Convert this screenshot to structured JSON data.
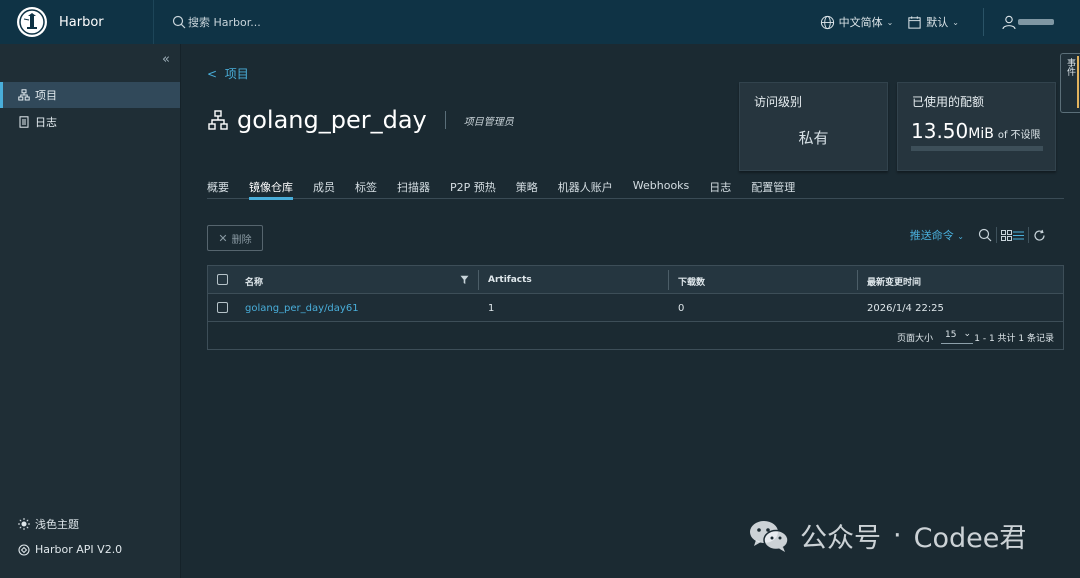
{
  "header": {
    "brand": "Harbor",
    "search_placeholder": "搜索 Harbor...",
    "language": "中文简体",
    "theme_default": "默认"
  },
  "sidebar": {
    "items": [
      {
        "label": "项目",
        "active": true
      },
      {
        "label": "日志",
        "active": false
      }
    ],
    "theme_toggle": "浅色主题",
    "api": "Harbor API V2.0"
  },
  "project": {
    "back_label": "项目",
    "name": "golang_per_day",
    "role": "项目管理员",
    "access_card": {
      "title": "访问级别",
      "value": "私有"
    },
    "quota_card": {
      "title": "已使用的配额",
      "amount": "13.50",
      "unit": "MiB",
      "of": "of",
      "limit": "不设限",
      "used_fraction": 0
    }
  },
  "tabs": [
    "概要",
    "镜像仓库",
    "成员",
    "标签",
    "扫描器",
    "P2P 预热",
    "策略",
    "机器人账户",
    "Webhooks",
    "日志",
    "配置管理"
  ],
  "active_tab": "镜像仓库",
  "toolbar": {
    "delete_label": "删除",
    "push_command": "推送命令"
  },
  "table": {
    "columns": [
      "名称",
      "Artifacts",
      "下载数",
      "最新变更时间"
    ],
    "rows": [
      {
        "name": "golang_per_day/day61",
        "artifacts": "1",
        "pulls": "0",
        "updated": "2026/1/4 22:25"
      }
    ],
    "page_size_label": "页面大小",
    "page_size": "15",
    "count_text": "1 - 1 共计 1 条记录"
  },
  "event_tab": "事件",
  "watermark": {
    "left": "公众号",
    "dot": "·",
    "right": "Codee君"
  },
  "colors": {
    "accent": "#49aeda",
    "header_bg": "#0f3345",
    "page_bg": "#1b2a32",
    "sidebar_bg": "#1f2e36"
  }
}
